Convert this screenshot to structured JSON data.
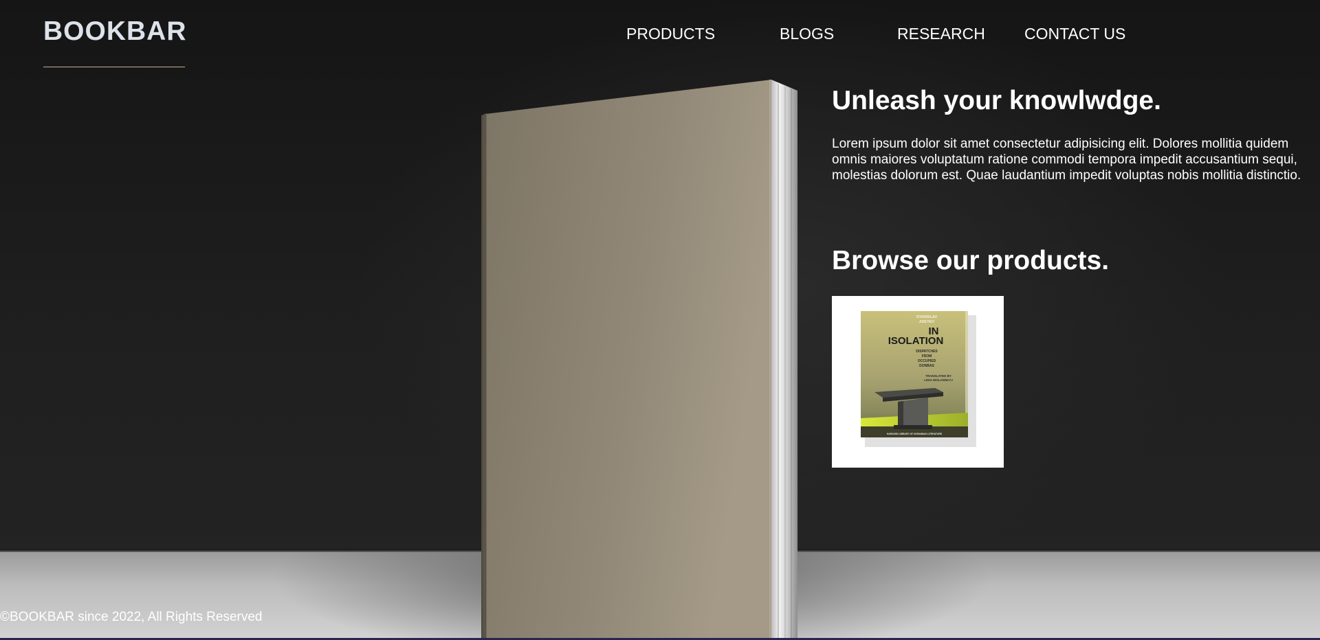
{
  "brand": {
    "name": "BOOKBAR"
  },
  "nav": {
    "products": "PRODUCTS",
    "blogs": "BLOGS",
    "research": "RESEARCH",
    "contact": "CONTACT US"
  },
  "hero": {
    "headline": "Unleash your knowlwdge.",
    "body": "Lorem ipsum dolor sit amet consectetur adipisicing elit. Dolores mollitia quidem omnis maiores voluptatum ratione commodi tempora impedit accusantium sequi, molestias dolorum est. Quae laudantium impedit voluptas nobis mollitia distinctio."
  },
  "products": {
    "heading": "Browse our products.",
    "items": [
      {
        "author": "STANISLAV ASEYEV",
        "title": "IN ISOLATION",
        "subtitle": "DISPATCHES FROM OCCUPIED DONBAS",
        "translator": "TRANSLATED BY LIDIA WOLANSKYJ",
        "series": "HARVARD LIBRARY OF UKRAINIAN LITERATURE"
      }
    ]
  },
  "footer": {
    "copyright": "©BOOKBAR since 2022, All Rights Reserved"
  },
  "colors": {
    "background": "#1c1c1c",
    "logo": "#dde2ea",
    "logo_rule": "#c9b38f",
    "book_cover": "#958b7a",
    "text": "#ffffff"
  }
}
